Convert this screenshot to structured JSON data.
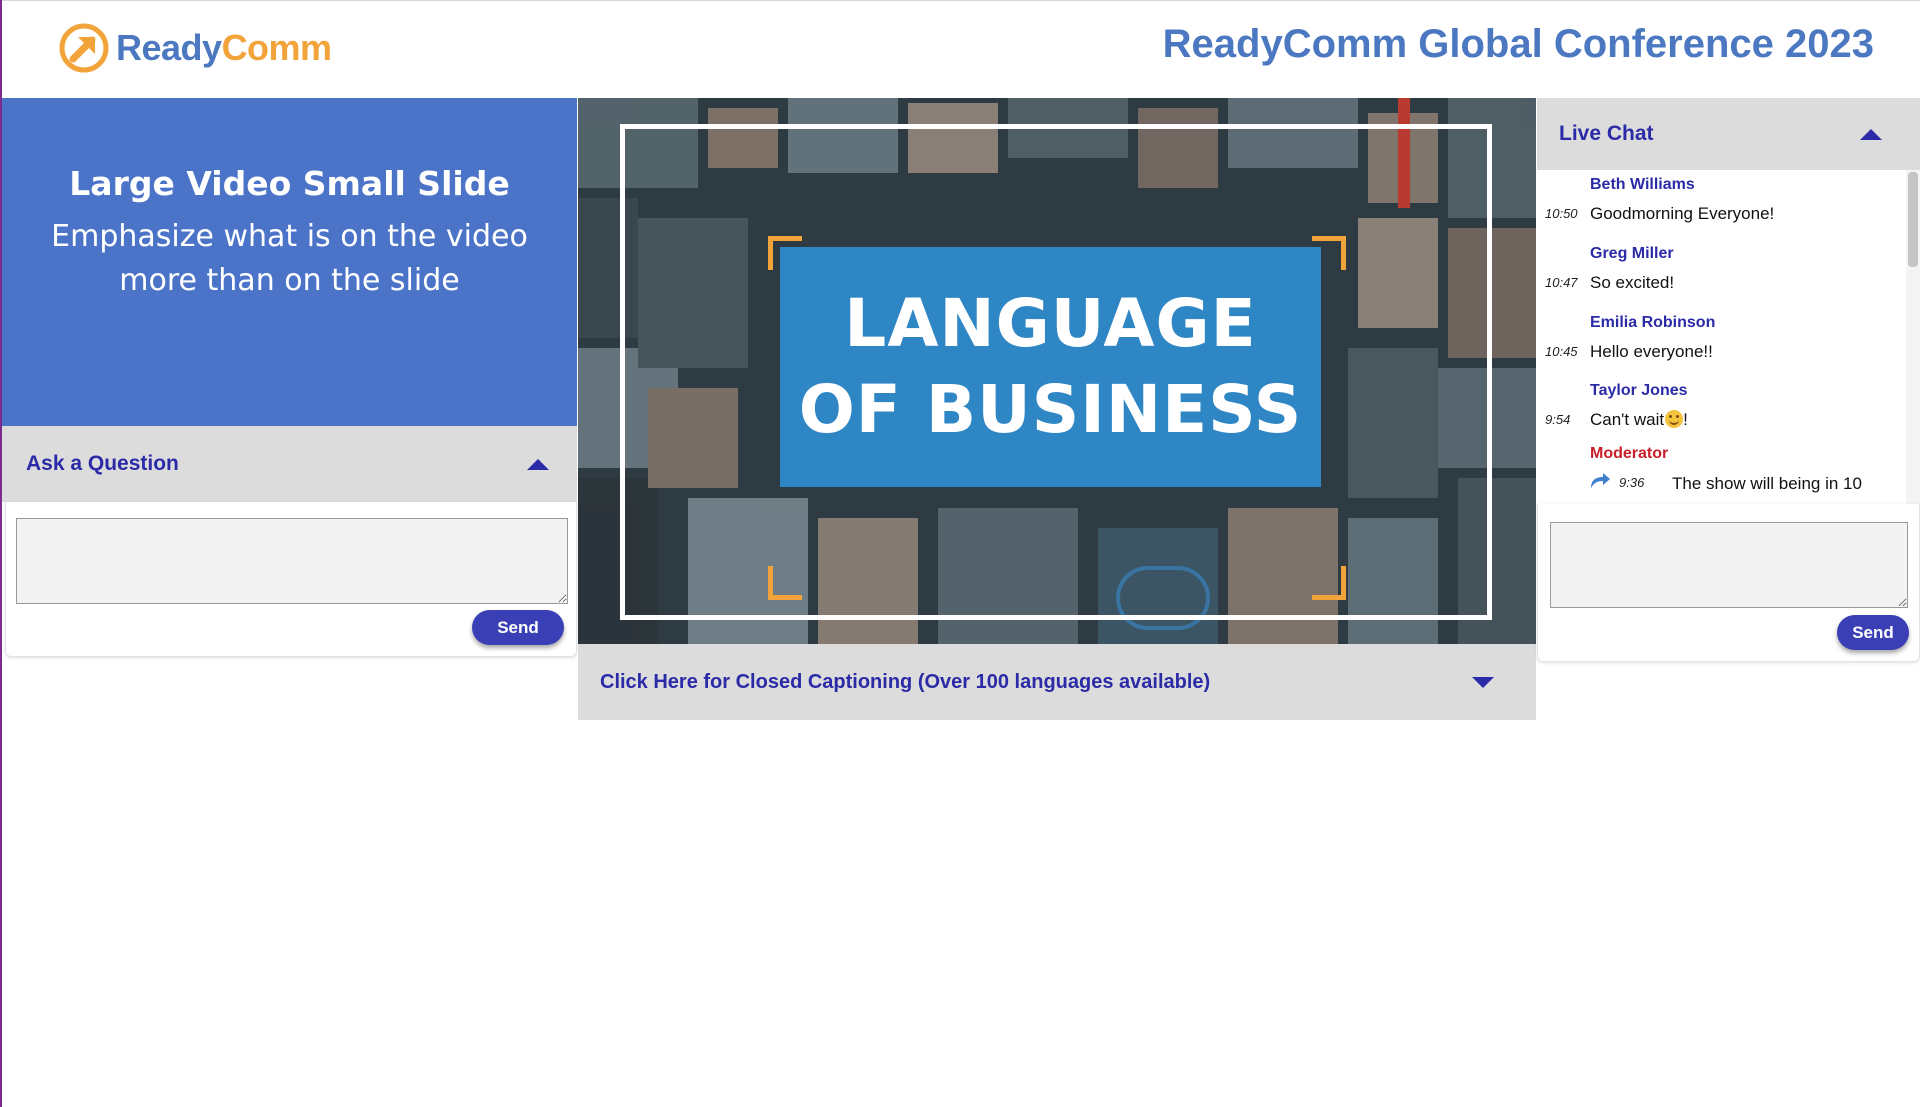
{
  "brand": {
    "ready": "Ready",
    "comm": "Comm",
    "accent": "#4b78c0",
    "orange": "#f2a33a"
  },
  "header": {
    "conference_title": "ReadyComm Global Conference 2023"
  },
  "slide": {
    "title": "Large Video Small Slide",
    "subtitle": "Emphasize what is on the video more than on the slide"
  },
  "ask": {
    "header_label": "Ask a Question",
    "input_value": "",
    "send_label": "Send"
  },
  "video": {
    "title_line1": "LANGUAGE",
    "title_line2": "OF BUSINESS"
  },
  "captioning": {
    "label": "Click Here for Closed Captioning (Over 100 languages available)"
  },
  "chat": {
    "header_label": "Live Chat",
    "messages": [
      {
        "name": "Beth Williams",
        "time": "10:50",
        "text": "Goodmorning Everyone!"
      },
      {
        "name": "Greg Miller",
        "time": "10:47",
        "text": "So excited!"
      },
      {
        "name": "Emilia Robinson",
        "time": "10:45",
        "text": "Hello everyone!!"
      },
      {
        "name": "Taylor Jones",
        "time": "9:54",
        "text_before": "Can't wait",
        "text_after": "!"
      },
      {
        "name": "Moderator",
        "time": "9:36",
        "text": "The show will being in 10"
      }
    ],
    "input_value": "",
    "send_label": "Send"
  },
  "icons": {
    "logo": "readycomm-arrow-logo-icon",
    "collapse": "caret-up-icon",
    "expand": "caret-down-icon",
    "reply": "reply-arrow-icon",
    "emoji": "smiley-face-icon"
  }
}
